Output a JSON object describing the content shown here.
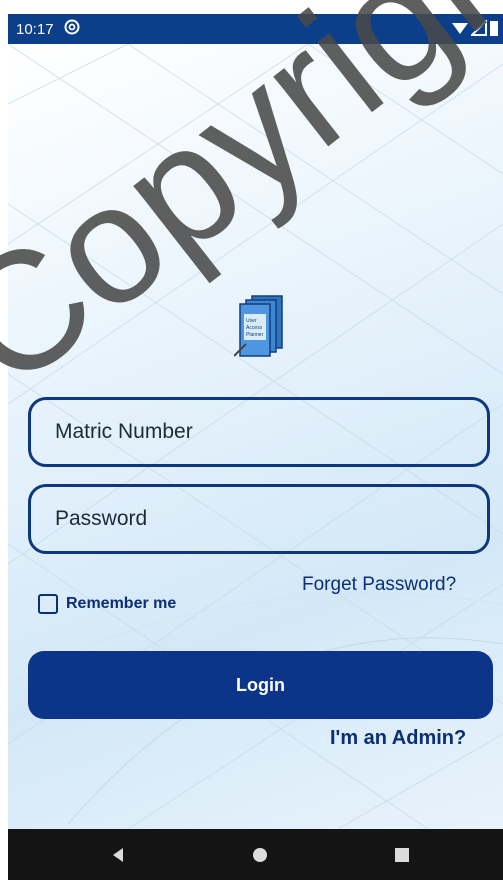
{
  "status_bar": {
    "time": "10:17",
    "notification_icon": "at-icon",
    "icons": [
      "wifi-icon",
      "signal-icon",
      "battery-icon"
    ]
  },
  "logo": {
    "icon": "planner-book-icon",
    "text": "User Access Planner"
  },
  "form": {
    "matric_placeholder": "Matric Number",
    "password_placeholder": "Password",
    "forget_password": "Forget Password?",
    "remember_me": "Remember me",
    "remember_checked": false,
    "login_label": "Login",
    "admin_link": "I'm an Admin?"
  },
  "nav_bar": {
    "buttons": [
      "back-icon",
      "home-icon",
      "recents-icon"
    ]
  },
  "watermark": {
    "text": "Copyright©"
  },
  "colors": {
    "primary": "#0c3589",
    "status_bar": "#0c3f8a",
    "nav_bar": "#141414",
    "background_light": "#e9f4fc"
  }
}
